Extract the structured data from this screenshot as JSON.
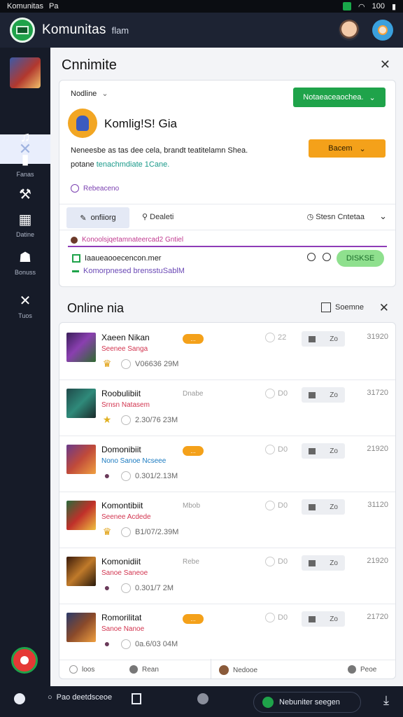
{
  "statusbar": {
    "left_items": [
      "Komunitas",
      "Pa"
    ],
    "battery": "100"
  },
  "topbar": {
    "title": "Komunitas",
    "subtitle": "flam"
  },
  "rail": {
    "items": [
      {
        "label": "Fanas",
        "icon": "music-icon"
      },
      {
        "label": "",
        "icon": "book-icon"
      },
      {
        "label": "Datine",
        "icon": "tool-icon"
      },
      {
        "label": "Bonuss",
        "icon": "ghost-icon"
      },
      {
        "label": "Tuos",
        "icon": "close-icon"
      }
    ]
  },
  "panel": {
    "title": "Cnnimite",
    "card": {
      "select_label": "Nodline",
      "primary_button": "Notaeaceaochea.",
      "group_name": "Komlig!S! Gia",
      "desc_line1": "Neneesbe as tas dee cela, brandt teatitelamn Shea.",
      "desc_line2_prefix": "potane ",
      "desc_line2_highlight": "tenachmdiate 1Cane.",
      "orange_button": "Bacem",
      "tagline": "Rebeaceno",
      "tabs": {
        "active": "onfiiorg",
        "second": "Dealeti",
        "right": "Stesn Cntetaa"
      },
      "chip_text": "Konoolsjqetamnateercad2 Gntiel",
      "row_a": "Iaaueaooecencon.mer",
      "row_b": "Komorpnesed brensstuSablM",
      "pill_button": "DISKSE"
    }
  },
  "section2": {
    "title": "Online nia",
    "action": "Soemne",
    "rows": [
      {
        "name": "Xaeen Nikan",
        "sub": "Seenee Sanga",
        "sub_color": "#d2344f",
        "badge": "...",
        "gray": "",
        "meta": "V06636 29M",
        "dim": "22",
        "btn": "Zo",
        "value": "31920",
        "icon": "crown-icon",
        "icon_glyph": "♛",
        "icon_color": "#e0a010",
        "thumb": "linear-gradient(135deg,#3a1f5a,#8a3fb0 45%,#2f6a2f)"
      },
      {
        "name": "Roobulibiit",
        "sub": "Srnsn Natasem",
        "sub_color": "#d2344f",
        "badge": "",
        "gray": "Dnabe",
        "meta": "2.30/76 23M",
        "dim": "D0",
        "btn": "Zo",
        "value": "31720",
        "icon": "star-icon",
        "icon_glyph": "★",
        "icon_color": "#e0b020",
        "thumb": "linear-gradient(135deg,#1f4a4a,#2f8a7a 50%,#1a2a2a)"
      },
      {
        "name": "Domonibiit",
        "sub": "Nono Sanoe Ncseee",
        "sub_color": "#1a7ac0",
        "badge": "...",
        "gray": "",
        "meta": "0.301/2.13M",
        "dim": "D0",
        "btn": "Zo",
        "value": "21920",
        "icon": "avatar-icon",
        "icon_glyph": "●",
        "icon_color": "#6a3a5a",
        "thumb": "linear-gradient(135deg,#6a3a8a,#c04a3a 50%,#f0a040)"
      },
      {
        "name": "Komontibiit",
        "sub": "Seenee Acdede",
        "sub_color": "#d2344f",
        "badge": "",
        "gray": "Mbob",
        "meta": "B1/07/2.39M",
        "dim": "D0",
        "btn": "Zo",
        "value": "31120",
        "icon": "crown-icon",
        "icon_glyph": "♛",
        "icon_color": "#e0a010",
        "thumb": "linear-gradient(135deg,#2a6a3a,#c0302a 50%,#f0c040)"
      },
      {
        "name": "Komonidiit",
        "sub": "Sanoe Saneoe",
        "sub_color": "#d2344f",
        "badge": "",
        "gray": "Rebe",
        "meta": "0.301/7 2M",
        "dim": "D0",
        "btn": "Zo",
        "value": "21920",
        "icon": "avatar-icon",
        "icon_glyph": "●",
        "icon_color": "#6a3a5a",
        "thumb": "linear-gradient(135deg,#3a1a0a,#c07a2a 50%,#2a1a0a)"
      },
      {
        "name": "Romorilitat",
        "sub": "Sanoe Nanoe",
        "sub_color": "#d2344f",
        "badge": "...",
        "gray": "",
        "meta": "0a.6/03 04M",
        "dim": "D0",
        "btn": "Zo",
        "value": "21720",
        "icon": "avatar-icon",
        "icon_glyph": "●",
        "icon_color": "#6a3a5a",
        "thumb": "linear-gradient(135deg,#2a3a6a,#8a4a2a 50%,#f0a040)"
      }
    ],
    "footer": {
      "left1": "loos",
      "left2": "Rean",
      "right1": "Nedooe",
      "right2": "Peoe"
    }
  },
  "bottombar": {
    "item1": "Pao deetdsceoe",
    "status": "Nebuniter seegen",
    "status_color": "#1fa34a"
  }
}
